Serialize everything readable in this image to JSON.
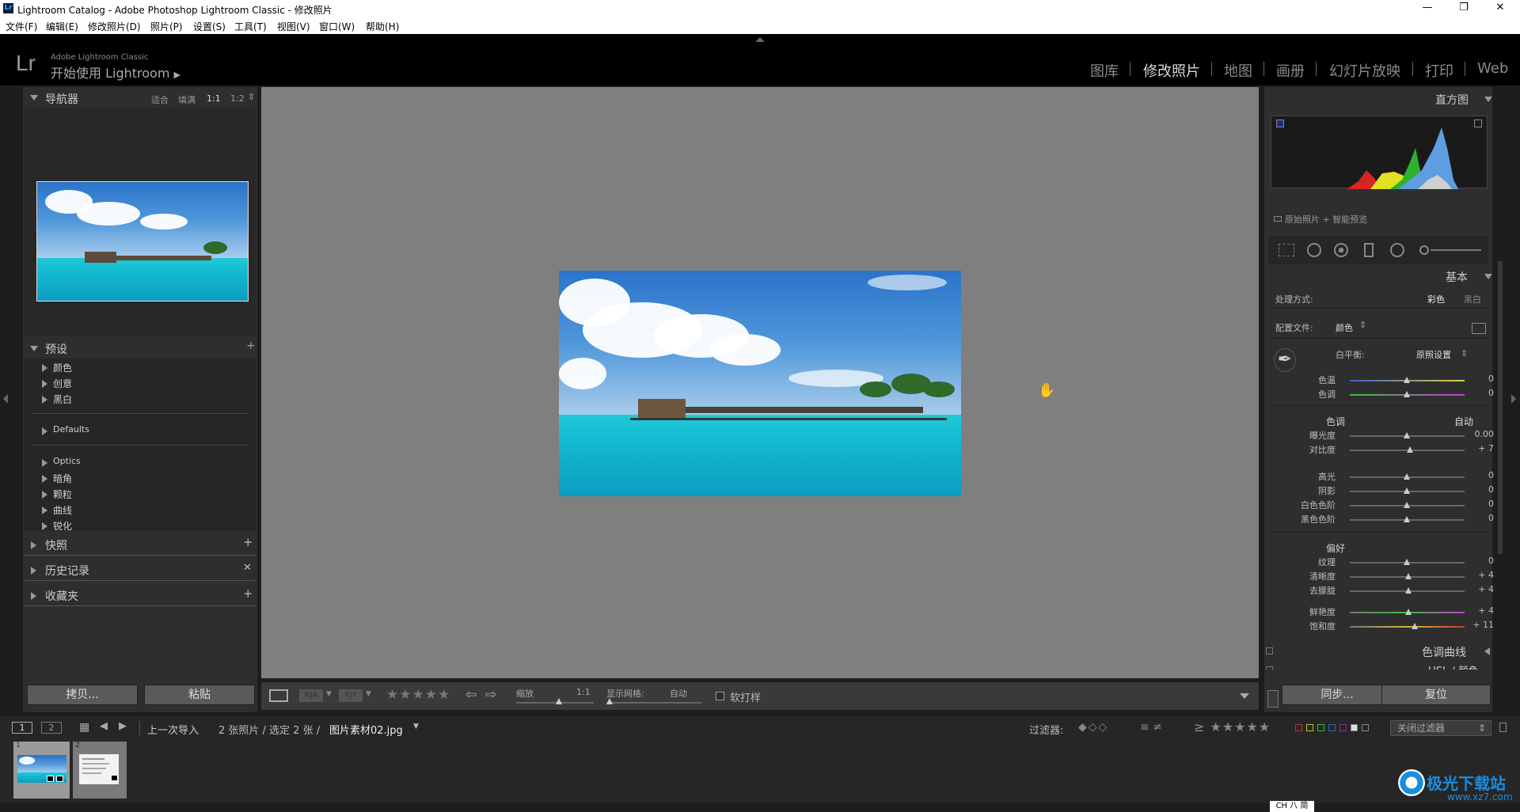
{
  "window": {
    "title": "Lightroom Catalog - Adobe Photoshop Lightroom Classic - 修改照片",
    "logo": "Lr"
  },
  "menu": [
    "文件(F)",
    "编辑(E)",
    "修改照片(D)",
    "照片(P)",
    "设置(S)",
    "工具(T)",
    "视图(V)",
    "窗口(W)",
    "帮助(H)"
  ],
  "identity": {
    "logo": "Lr",
    "product": "Adobe Lightroom Classic",
    "start": "开始使用 Lightroom"
  },
  "modules": [
    {
      "label": "图库",
      "active": false
    },
    {
      "label": "修改照片",
      "active": true
    },
    {
      "label": "地图",
      "active": false
    },
    {
      "label": "画册",
      "active": false
    },
    {
      "label": "幻灯片放映",
      "active": false
    },
    {
      "label": "打印",
      "active": false
    },
    {
      "label": "Web",
      "active": false
    }
  ],
  "navigator": {
    "title": "导航器",
    "zoom": [
      "适合",
      "填满",
      "1:1",
      "1:2"
    ]
  },
  "presets": {
    "title": "预设",
    "items": [
      "颜色",
      "创意",
      "黑白",
      "Defaults",
      "Optics",
      "暗角",
      "颗粒",
      "曲线",
      "锐化"
    ]
  },
  "snapshots": {
    "title": "快照"
  },
  "history": {
    "title": "历史记录"
  },
  "collections": {
    "title": "收藏夹"
  },
  "left_buttons": {
    "copy": "拷贝...",
    "paste": "粘贴"
  },
  "histogram": {
    "title": "直方图",
    "footer": "原始照片 + 智能预览"
  },
  "basic": {
    "title": "基本",
    "treatment_label": "处理方式:",
    "treatment_color": "彩色",
    "treatment_bw": "黑白",
    "profile_label": "配置文件:",
    "profile_value": "颜色",
    "wb_label": "白平衡:",
    "wb_value": "原照设置",
    "tone_label": "色调",
    "auto": "自动",
    "presence_label": "偏好",
    "sliders_wb": [
      {
        "label": "色温",
        "value": "0"
      },
      {
        "label": "色调",
        "value": "0"
      }
    ],
    "sliders_tone1": [
      {
        "label": "曝光度",
        "value": "0.00"
      },
      {
        "label": "对比度",
        "value": "+ 7"
      }
    ],
    "sliders_tone2": [
      {
        "label": "高光",
        "value": "0"
      },
      {
        "label": "阴影",
        "value": "0"
      },
      {
        "label": "白色色阶",
        "value": "0"
      },
      {
        "label": "黑色色阶",
        "value": "0"
      }
    ],
    "sliders_presence1": [
      {
        "label": "纹理",
        "value": "0"
      },
      {
        "label": "清晰度",
        "value": "+ 4"
      },
      {
        "label": "去朦胧",
        "value": "+ 4"
      }
    ],
    "sliders_presence2": [
      {
        "label": "鲜艳度",
        "value": "+ 4"
      },
      {
        "label": "饱和度",
        "value": "+ 11"
      }
    ]
  },
  "tone_curve": {
    "title": "色调曲线"
  },
  "hsl": {
    "title": "HSL / 颜色"
  },
  "right_buttons": {
    "sync": "同步...",
    "reset": "复位"
  },
  "toolbar": {
    "zoom_label": "缩放",
    "zoom_value": "1:1",
    "grid_label": "显示网格:",
    "grid_value": "自动",
    "softproof": "软打样"
  },
  "filmbar": {
    "page1": "1",
    "page2": "2",
    "source": "上一次导入",
    "count": "2 张照片 / 选定 2 张 /",
    "filename": "图片素材02.jpg",
    "filter_label": "过滤器:",
    "filter_value": "关闭过滤器"
  },
  "thumbs": [
    {
      "index": "1"
    },
    {
      "index": "2"
    }
  ],
  "watermark": {
    "name": "极光下载站",
    "url": "www.xz7.com"
  },
  "ime": "CH 八 简"
}
